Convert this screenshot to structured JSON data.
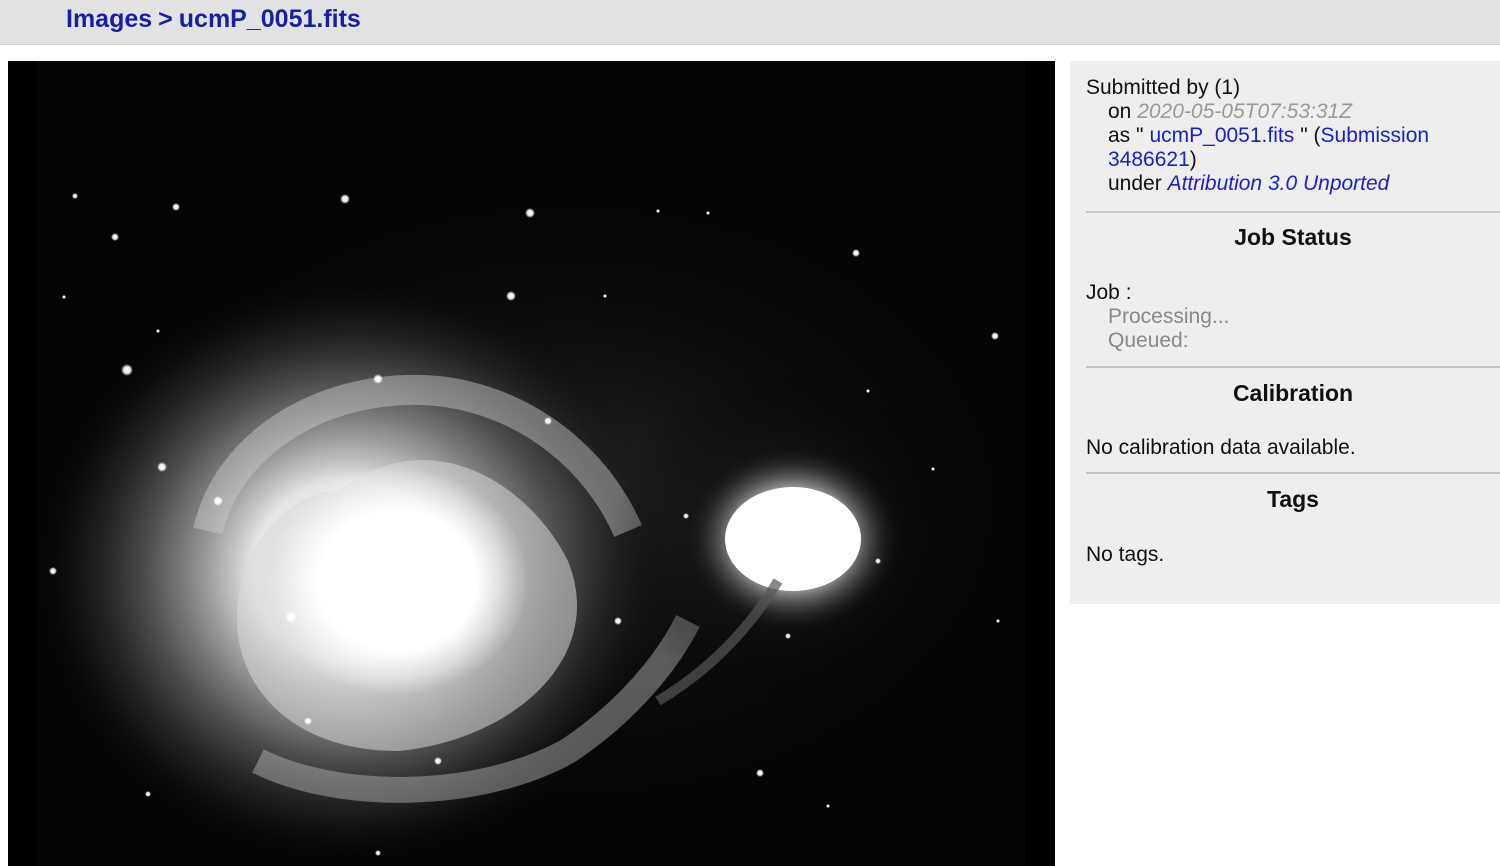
{
  "breadcrumb": {
    "root_label": "Images",
    "separator": ">",
    "current_label": "ucmP_0051.fits"
  },
  "image": {
    "icon": "galaxy-image"
  },
  "submission": {
    "submitted_by_label": "Submitted by",
    "submitter": "(1)",
    "on_label": "on",
    "date": "2020-05-05T07:53:31Z",
    "as_label": "as \"",
    "filename_link": "ucmP_0051.fits",
    "as_close": "\" (",
    "submission_link_part1": "Submission",
    "submission_link_part2": "3486621",
    "close_paren": ")",
    "under_label": "under",
    "license_link": "Attribution 3.0 Unported"
  },
  "job_status": {
    "heading": "Job Status",
    "job_label": "Job :",
    "processing": "Processing...",
    "queued": "Queued:"
  },
  "calibration": {
    "heading": "Calibration",
    "text": "No calibration data available."
  },
  "tags": {
    "heading": "Tags",
    "text": "No tags."
  },
  "colors": {
    "link": "#1a1fcc",
    "breadcrumb": "#1a1f9e",
    "sidebar_bg": "#eeeeee",
    "topbar_bg": "#e2e2e2"
  }
}
